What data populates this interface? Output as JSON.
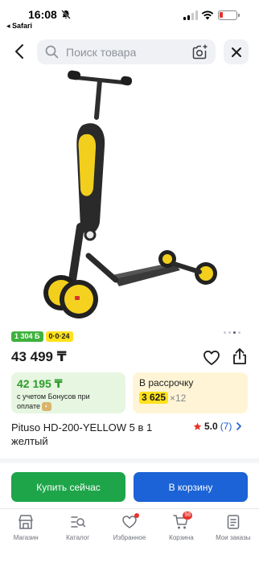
{
  "status_bar": {
    "time": "16:08",
    "back_app": "◂ Safari"
  },
  "search": {
    "placeholder": "Поиск товара"
  },
  "product": {
    "badge_bonus": "1 304 Б",
    "badge_installment": "0·0·24",
    "price": "43 499 ₸",
    "title": "Pituso HD-200-YELLOW 5 в 1 желтый",
    "rating": "5.0",
    "reviews": "(7)",
    "image_count": 4,
    "image_index": 3
  },
  "bonus_card": {
    "price": "42 195 ₸",
    "text": "с учетом Бонусов при оплате"
  },
  "credit_card": {
    "title": "В рассрочку",
    "amount": "3 625",
    "months": "×12"
  },
  "actions": {
    "buy_now": "Купить сейчас",
    "to_cart": "В корзину"
  },
  "nav": {
    "items": [
      {
        "label": "Магазин",
        "icon": "shop-icon"
      },
      {
        "label": "Каталог",
        "icon": "catalog-icon"
      },
      {
        "label": "Избранное",
        "icon": "heart-icon"
      },
      {
        "label": "Корзина",
        "icon": "cart-icon",
        "badge": "98"
      },
      {
        "label": "Мои заказы",
        "icon": "orders-icon"
      }
    ]
  },
  "colors": {
    "green": "#1ea54a",
    "blue": "#1b63d6",
    "yellow": "#ffe21b",
    "red": "#e8322b"
  }
}
